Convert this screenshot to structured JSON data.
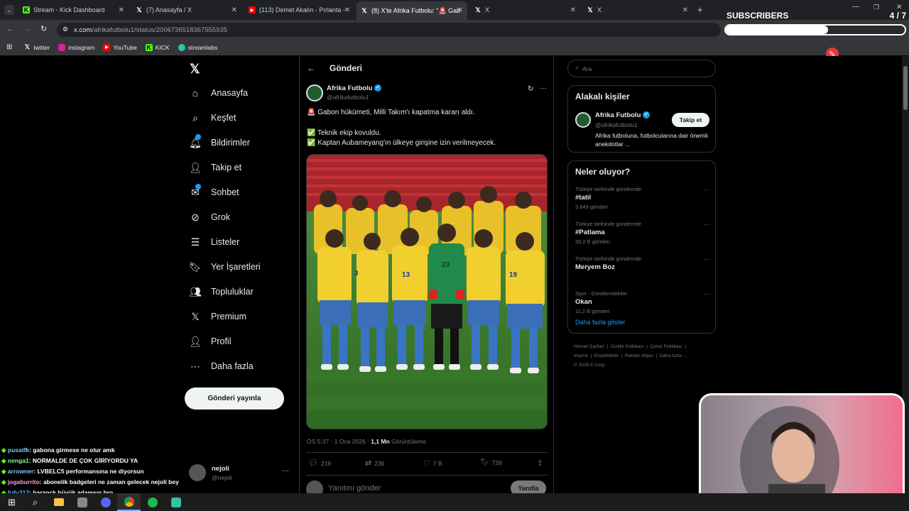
{
  "browser": {
    "tabs": [
      {
        "title": "Stream - Kick Dashboard",
        "icon": "kick-icon"
      },
      {
        "title": "(7) Anasayfa / X",
        "icon": "x-icon"
      },
      {
        "title": "(113) Demet Akalın - Pırlanta -",
        "icon": "youtube-icon"
      },
      {
        "title": "(8) X'te Afrika Futbolu: \"🚨 Gab",
        "icon": "x-icon"
      },
      {
        "title": "X",
        "icon": "x-icon"
      },
      {
        "title": "X",
        "icon": "x-icon"
      }
    ],
    "url_host": "x.com",
    "url_path": "/afrikafutbolu1/status/2006736518367555935",
    "bookmarks": [
      "twitter",
      "instagram",
      "YouTube",
      "KICK",
      "streamlabs"
    ]
  },
  "overlay": {
    "subscribers_label": "SUBSCRIBERS",
    "subscribers_count": "4 / 7",
    "subscribers_progress": 0.57
  },
  "nav": {
    "items": [
      "Anasayfa",
      "Keşfet",
      "Bildirimler",
      "Takip et",
      "Sohbet",
      "Grok",
      "Listeler",
      "Yer İşaretleri",
      "Topluluklar",
      "Premium",
      "Profil",
      "Daha fazla"
    ],
    "post_button": "Gönderi yayınla",
    "account_name": "nejoli",
    "account_handle": "@nejoli"
  },
  "post": {
    "header_title": "Gönderi",
    "author_name": "Afrika Futbolu",
    "author_handle": "@afrikafutbolu1",
    "line1": "🚨 Gabon hükümeti, Milli Takım'ı kapatma kararı aldı.",
    "line2": "✅ Teknik ekip kovuldu.",
    "line3": "✅ Kaptan Aubameyang'ın ülkeye girişine izin verilmeyecek.",
    "time": "ÖS 5:37 · 1 Oca 2026 ·",
    "views_count": "1,1 Mn",
    "views_label": "Görüntüleme",
    "replies": "219",
    "reposts": "236",
    "likes": "7 B",
    "bookmarks": "739",
    "reply_placeholder": "Yanıtını gönder",
    "reply_button": "Yanıtla"
  },
  "sidebar": {
    "search_placeholder": "Ara",
    "related_title": "Alakalı kişiler",
    "related_name": "Afrika Futbolu",
    "related_handle": "@afrikafutbolu1",
    "related_bio": "Afrika futboluna, futbolcularına dair önemli anekdotlar ...",
    "follow_button": "Takip et",
    "trends_title": "Neler oluyor?",
    "trends": [
      {
        "meta": "Türkiye tarihinde gündemde",
        "name": "#tatil",
        "count": "3.849 gönderi"
      },
      {
        "meta": "Türkiye tarihinde gündemde",
        "name": "#Patlama",
        "count": "30,2 B gönderi"
      },
      {
        "meta": "Türkiye tarihinde gündemde",
        "name": "Meryem Boz",
        "count": ""
      },
      {
        "meta": "Spor · Gündemdekiler",
        "name": "Okan",
        "count": "11,2 B gönderi"
      }
    ],
    "show_more": "Daha fazla göster",
    "footer": [
      "Hizmet Şartları",
      "Gizlilik Politikası",
      "Çerez Politikası",
      "Imprint",
      "Erişilebilirlik",
      "Reklam bilgisi",
      "Daha fazla ...",
      "© 2026 X Corp."
    ]
  },
  "chat": [
    {
      "user": "pusatfk",
      "msg": ": gabona girmese ne olur amk",
      "color": "#7ec8ff"
    },
    {
      "user": "nenga1",
      "msg": ": NORMALDE DE ÇOK GİRİYORDU YA",
      "color": "#8cff8c"
    },
    {
      "user": "arrowner",
      "msg": ": LVBELC5 performansına ne diyorsun",
      "color": "#7ec8ff"
    },
    {
      "user": "jogaburrito",
      "msg": ": abonelik badgeleri ne zaman gelecek nejoli bey",
      "color": "#ff9de2"
    },
    {
      "user": "fufu312",
      "msg": ": baranck büyük adamsın bro",
      "color": "#5fb3ff"
    }
  ],
  "colors": {
    "accent": "#1d9bf0",
    "kick_green": "#53fc18"
  }
}
